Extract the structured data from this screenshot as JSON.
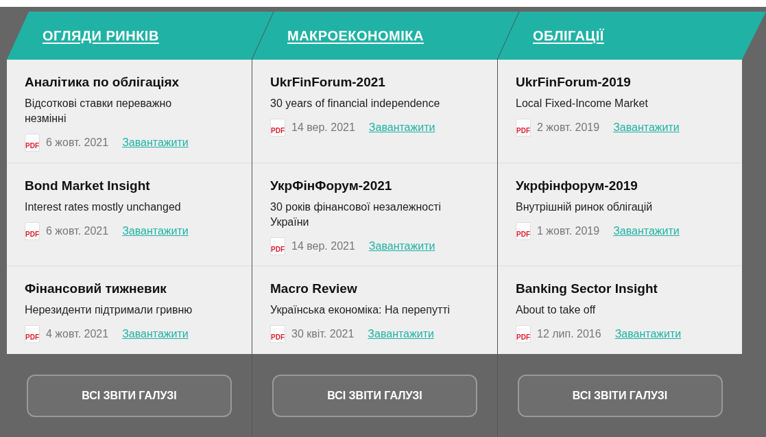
{
  "columns": [
    {
      "heading": "ОГЛЯДИ РИНКІВ",
      "items": [
        {
          "title": "Аналітика по облігаціях",
          "subtitle": "Відсоткові ставки переважно незмінні",
          "file_label": "PDF",
          "date": "6 жовт. 2021",
          "link": "Завантажити"
        },
        {
          "title": "Bond Market Insight",
          "subtitle": "Interest rates mostly unchanged",
          "file_label": "PDF",
          "date": "6 жовт. 2021",
          "link": "Завантажити"
        },
        {
          "title": "Фінансовий тижневик",
          "subtitle": "Нерезиденти підтримали гривню",
          "file_label": "PDF",
          "date": "4 жовт. 2021",
          "link": "Завантажити"
        }
      ],
      "button": "ВСІ ЗВІТИ ГАЛУЗІ"
    },
    {
      "heading": "МАКРОЕКОНОМІКА",
      "items": [
        {
          "title": "UkrFinForum-2021",
          "subtitle": "30 years of financial independence",
          "file_label": "PDF",
          "date": "14 вер. 2021",
          "link": "Завантажити"
        },
        {
          "title": "УкрФінФорум-2021",
          "subtitle": "30 років фінансової незалежності України",
          "file_label": "PDF",
          "date": "14 вер. 2021",
          "link": "Завантажити"
        },
        {
          "title": "Macro Review",
          "subtitle": "Українська економіка: На перепутті",
          "file_label": "PDF",
          "date": "30 квіт. 2021",
          "link": "Завантажити"
        }
      ],
      "button": "ВСІ ЗВІТИ ГАЛУЗІ"
    },
    {
      "heading": "ОБЛІГАЦІЇ",
      "items": [
        {
          "title": "UkrFinForum-2019",
          "subtitle": "Local Fixed-Income Market",
          "file_label": "PDF",
          "date": "2 жовт. 2019",
          "link": "Завантажити"
        },
        {
          "title": "Укрфінфорум-2019",
          "subtitle": "Внутрішній ринок облігацій",
          "file_label": "PDF",
          "date": "1 жовт. 2019",
          "link": "Завантажити"
        },
        {
          "title": "Banking Sector Insight",
          "subtitle": "About to take off",
          "file_label": "PDF",
          "date": "12 лип. 2016",
          "link": "Завантажити"
        }
      ],
      "button": "ВСІ ЗВІТИ ГАЛУЗІ"
    }
  ]
}
